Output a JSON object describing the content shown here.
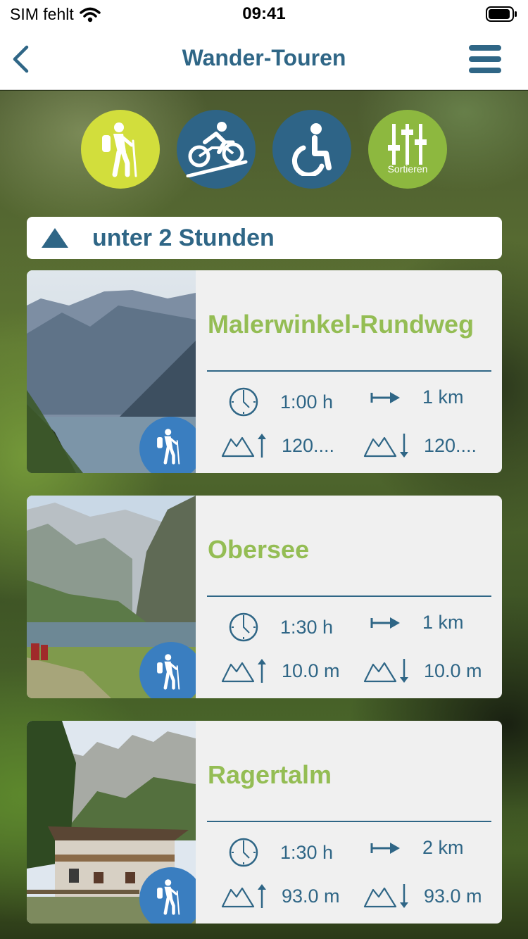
{
  "status_bar": {
    "carrier": "SIM fehlt",
    "time": "09:41"
  },
  "navbar": {
    "title": "Wander-Touren"
  },
  "filters": {
    "sort_label": "Sortieren"
  },
  "section": {
    "title": "unter 2 Stunden"
  },
  "colors": {
    "primary_blue": "#2f6686",
    "title_green": "#94bd54",
    "hike_yellow": "#d2de3c",
    "sort_green": "#8db83f",
    "badge_blue": "#3a7ec0"
  },
  "tours": [
    {
      "title": "Malerwinkel-Rundweg",
      "duration": "1:00 h",
      "distance": "1 km",
      "ascent": "120....",
      "descent": "120...."
    },
    {
      "title": "Obersee",
      "duration": "1:30 h",
      "distance": "1 km",
      "ascent": "10.0 m",
      "descent": "10.0 m"
    },
    {
      "title": "Ragertalm",
      "duration": "1:30 h",
      "distance": "2 km",
      "ascent": "93.0 m",
      "descent": "93.0 m"
    }
  ]
}
